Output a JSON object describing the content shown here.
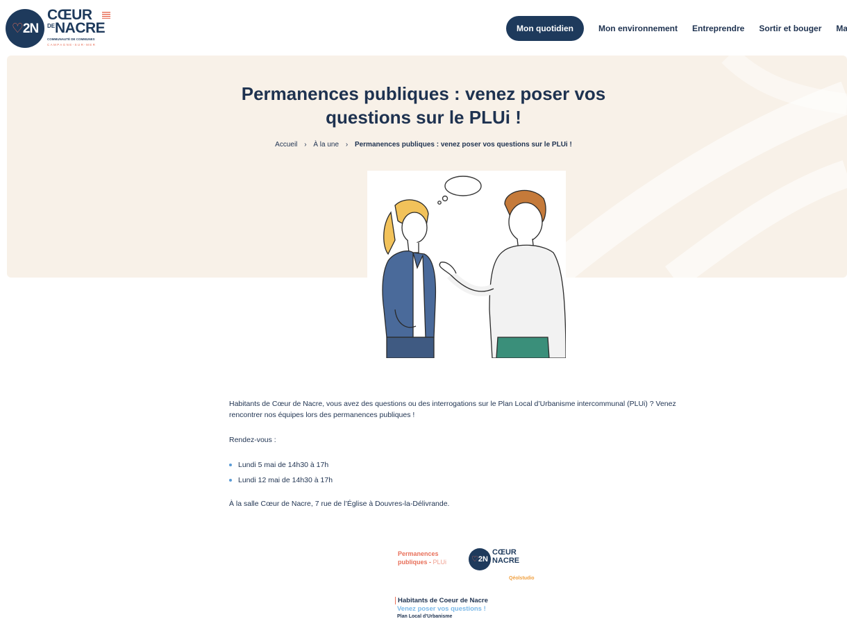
{
  "logo": {
    "monogram_left": "♡",
    "monogram_right": "2N",
    "line1": "CŒUR",
    "de": "DE",
    "line2": "NACRE",
    "sub1": "COMMUNAUTÉ DE COMMUNES",
    "sub2": "CAMPAGNE-SUR-MER"
  },
  "nav": {
    "items": [
      {
        "label": "Mon quotidien",
        "active": true
      },
      {
        "label": "Mon environnement",
        "active": false
      },
      {
        "label": "Entreprendre",
        "active": false
      },
      {
        "label": "Sortir et bouger",
        "active": false
      },
      {
        "label": "Ma co",
        "active": false
      }
    ]
  },
  "hero": {
    "title_line1": "Permanences publiques : venez poser vos",
    "title_line2": "questions sur le PLUi !",
    "breadcrumb": {
      "home": "Accueil",
      "section": "À la une",
      "separator": "›",
      "current": "Permanences publiques : venez poser vos questions sur le PLUi !"
    }
  },
  "article": {
    "intro": "Habitants de Cœur de Nacre, vous avez des questions ou des interrogations sur le Plan Local d’Urbanisme intercommunal (PLUi) ? Venez rencontrer nos équipes lors des permanences publiques !",
    "rendezvous": "Rendez-vous :",
    "dates": [
      "Lundi 5 mai de 14h30 à 17h",
      "Lundi 12 mai de 14h30 à 17h"
    ],
    "location": "À la salle Cœur de Nacre, 7 rue de l’Église à Douvres-la-Délivrande."
  },
  "card": {
    "title_a": "Permanences",
    "title_b": "publiques - ",
    "title_c": "PLUi",
    "logo_mono": "2N",
    "logo_heart": "♡",
    "logo_l1": "CŒUR",
    "logo_l2": "NACRE",
    "brand": "Qéolstudio",
    "h1": "Habitants de Coeur de Nacre",
    "h2": "Venez poser vos questions !",
    "h3": "Plan Local d’Urbanisme"
  },
  "colors": {
    "navy": "#1e3a5c",
    "coral": "#e8705a",
    "hero_bg": "#f8f1e8",
    "bullet": "#5b9bd5"
  }
}
